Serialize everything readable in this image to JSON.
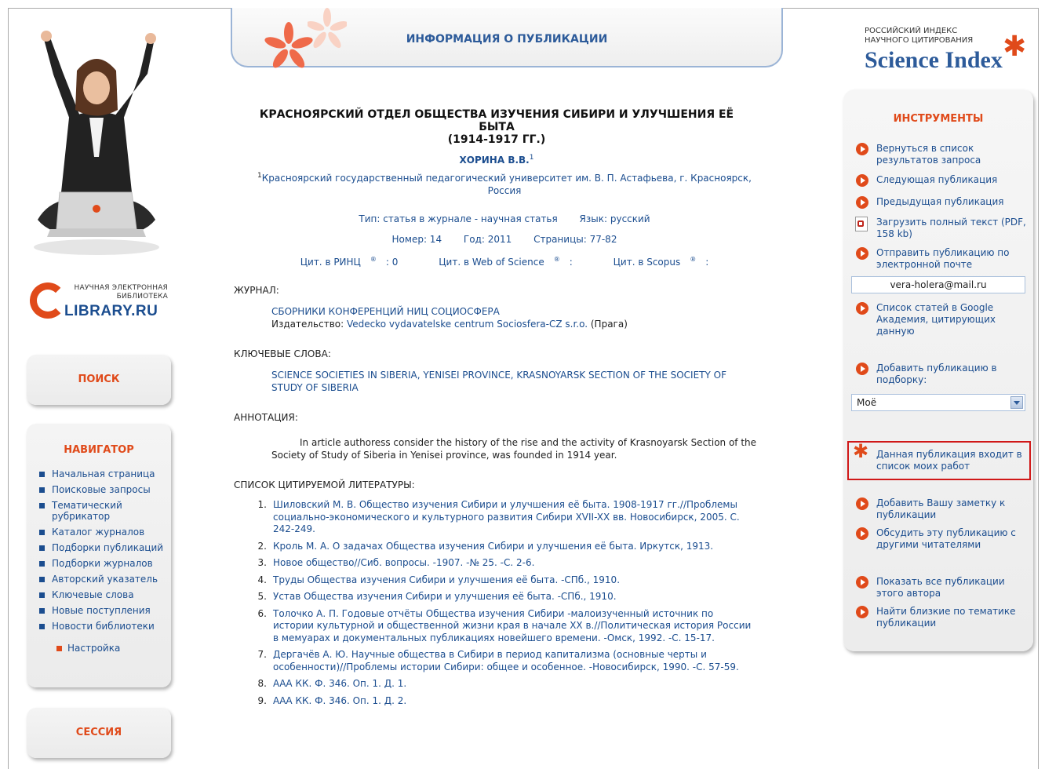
{
  "header": {
    "title": "ИНФОРМАЦИЯ О ПУБЛИКАЦИИ"
  },
  "science_index": {
    "sub1": "РОССИЙСКИЙ ИНДЕКС",
    "sub2": "НАУЧНОГО ЦИТИРОВАНИЯ",
    "name": "Science Index"
  },
  "elibrary": {
    "sub1": "НАУЧНАЯ ЭЛЕКТРОННАЯ",
    "sub2": "БИБЛИОТЕКА",
    "name": "LIBRARY.RU"
  },
  "left": {
    "search_label": "ПОИСК",
    "navigator_title": "НАВИГАТОР",
    "nav_items": [
      "Начальная страница",
      "Поисковые запросы",
      "Тематический рубрикатор",
      "Каталог журналов",
      "Подборки публикаций",
      "Подборки журналов",
      "Авторский указатель",
      "Ключевые слова",
      "Новые поступления",
      "Новости библиотеки"
    ],
    "settings_label": "Настройка",
    "session_label": "СЕССИЯ"
  },
  "publication": {
    "title_line1": "КРАСНОЯРСКИЙ ОТДЕЛ ОБЩЕСТВА ИЗУЧЕНИЯ СИБИРИ И УЛУЧШЕНИЯ ЕЁ БЫТА",
    "title_line2": "(1914-1917 ГГ.)",
    "author": "ХОРИНА В.В.",
    "author_sup": "1",
    "affil_sup": "1",
    "affiliation": "Красноярский государственный педагогический университет им. В. П. Астафьева, г. Красноярск, Россия",
    "type": "Тип: статья в журнале - научная статья",
    "language": "Язык: русский",
    "number": "Номер: 14",
    "year": "Год: 2011",
    "pages": "Страницы: 77-82",
    "cit_rinc": "Цит. в РИНЦ",
    "cit_rinc_val": ": 0",
    "cit_wos": "Цит. в Web of Science",
    "cit_wos_val": ":",
    "cit_scopus": "Цит. в Scopus",
    "cit_scopus_val": ":",
    "reg_mark": "®",
    "journal_label": "ЖУРНАЛ:",
    "journal_name": "СБОРНИКИ КОНФЕРЕНЦИЙ НИЦ СОЦИОСФЕРА",
    "publisher_prefix": "Издательство: ",
    "publisher": "Vedecko vydavatelske centrum Sociosfera-CZ s.r.o.",
    "publisher_city": " (Прага)",
    "keywords_label": "КЛЮЧЕВЫЕ СЛОВА:",
    "keywords": "SCIENCE SOCIETIES IN SIBERIA, YENISEI PROVINCE, KRASNOYARSK SECTION OF THE SOCIETY OF STUDY OF SIBERIA",
    "abstract_label": "АННОТАЦИЯ:",
    "abstract": "In article authoress consider the history of the rise and the activity of Krasnoyarsk Section of the Society of Study of Siberia in Yenisei province, was founded in 1914 year.",
    "refs_label": "СПИСОК ЦИТИРУЕМОЙ ЛИТЕРАТУРЫ:",
    "refs": [
      "Шиловский М. В. Общество изучения Сибири и улучшения её быта. 1908-1917 гг.//Проблемы социально-экономического и культурного развития Сибири XVII-XX вв. Новосибирск, 2005. С. 242-249.",
      "Кроль М. А. О задачах Общества изучения Сибири и улучшения её быта. Иркутск, 1913.",
      "Новое общество//Сиб. вопросы. -1907. -№ 25. -С. 2-6.",
      "Труды Общества изучения Сибири и улучшения её быта. -СПб., 1910.",
      "Устав Общества изучения Сибири и улучшения её быта. -СПб., 1910.",
      "Толочко А. П. Годовые отчёты Общества изучения Сибири -малоизученный источник по истории культурной и общественной жизни края в начале XX в.//Политическая история России в мемуарах и документальных публикациях новейшего времени. -Омск, 1992. -С. 15-17.",
      "Дергачёв А. Ю. Научные общества в Сибири в период капитализма (основные черты и особенности)//Проблемы истории Сибири: общее и особенное. -Новосибирск, 1990. -С. 57-59.",
      "ААА КК. Ф. 346. Оп. 1. Д. 1.",
      "ААА КК. Ф. 346. Оп. 1. Д. 2."
    ],
    "ref_numbers": [
      "1.",
      "2.",
      "3.",
      "4.",
      "5.",
      "6.",
      "7.",
      "8.",
      "9."
    ]
  },
  "tools": {
    "title": "ИНСТРУМЕНТЫ",
    "back": "Вернуться в список результатов запроса",
    "next": "Следующая публикация",
    "prev": "Предыдущая публикация",
    "download": "Загрузить полный текст (PDF, 158 kb)",
    "send": "Отправить публикацию по электронной почте",
    "email": "vera-holera@mail.ru",
    "google": "Список статей в Google Академия, цитирующих данную",
    "add_to": "Добавить публикацию в подборку:",
    "select_value": "Моё",
    "in_my_works": "Данная публикация входит в список моих работ",
    "add_note": "Добавить Вашу заметку к публикации",
    "discuss": "Обсудить эту публикацию с другими читателями",
    "show_all": "Показать все публикации этого автора",
    "similar": "Найти близкие по тематике публикации"
  },
  "colors": {
    "accent": "#e04a1a",
    "link": "#1b4d8f",
    "highlight": "#d01818"
  }
}
